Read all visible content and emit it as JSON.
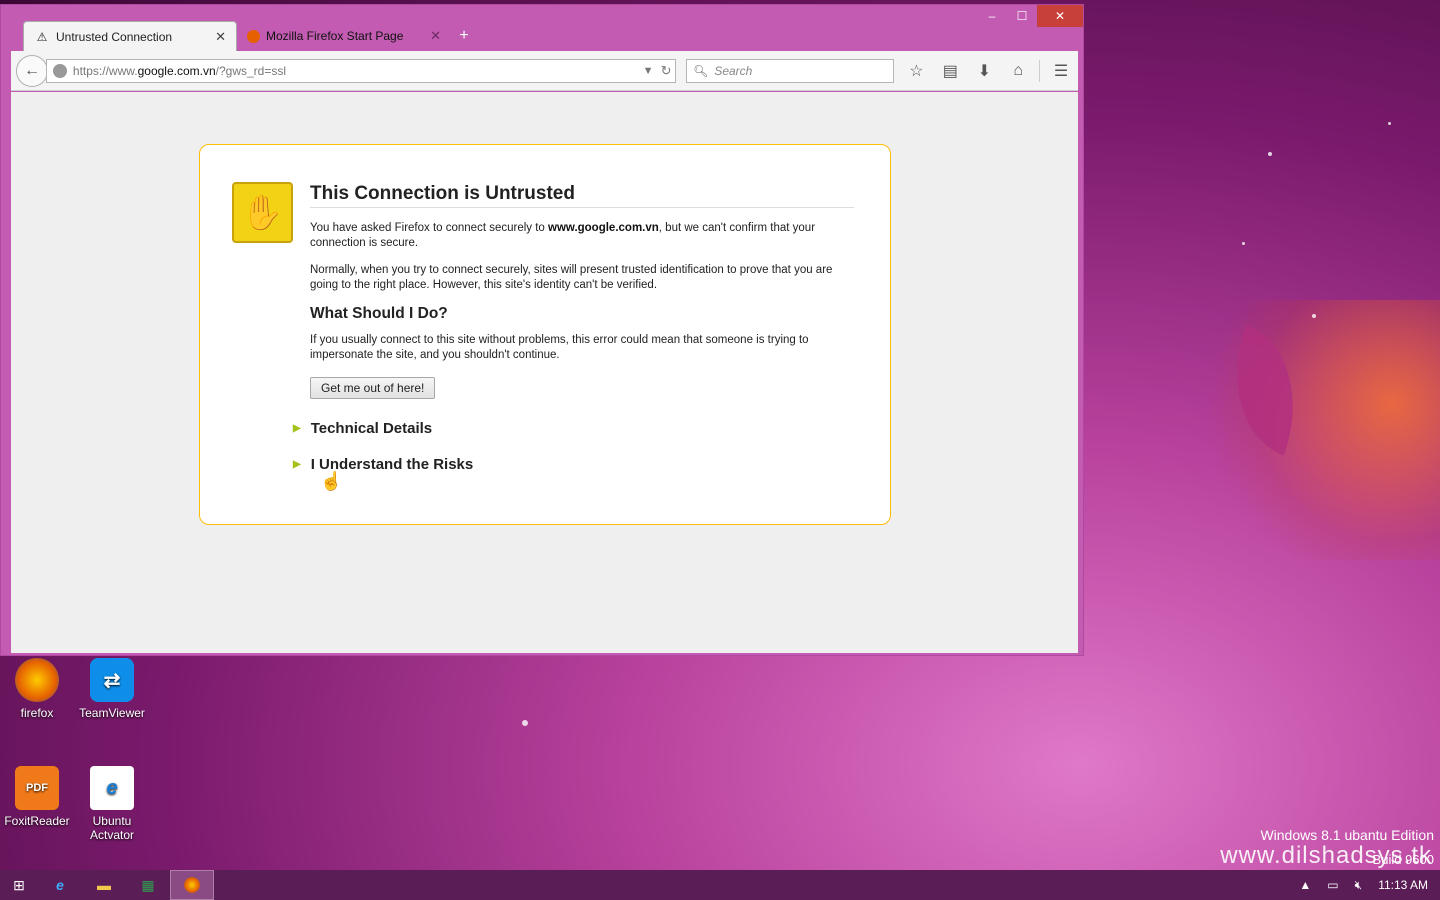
{
  "window": {
    "tabs": [
      {
        "label": "Untrusted Connection",
        "icon": "warning-icon"
      },
      {
        "label": "Mozilla Firefox Start Page",
        "icon": "firefox-icon"
      }
    ],
    "new_tab": "+",
    "controls": {
      "minimize": "–",
      "maximize": "☐",
      "close": "✕"
    }
  },
  "navbar": {
    "url_prefix": "https://www.",
    "url_host": "google.com.vn",
    "url_path": "/?gws_rd=ssl",
    "search_placeholder": "Search"
  },
  "error": {
    "title": "This Connection is Untrusted",
    "p1_before": "You have asked Firefox to connect securely to ",
    "p1_host": "www.google.com.vn",
    "p1_after": ", but we can't confirm that your connection is secure.",
    "p2": "Normally, when you try to connect securely, sites will present trusted identification to prove that you are going to the right place. However, this site's identity can't be verified.",
    "h2": "What Should I Do?",
    "p3": "If you usually connect to this site without problems, this error could mean that someone is trying to impersonate the site, and you shouldn't continue.",
    "button": "Get me out of here!",
    "technical_details": "Technical Details",
    "understand_risks": "I Understand the Risks"
  },
  "desktop": {
    "icons": [
      {
        "label": "firefox"
      },
      {
        "label": "TeamViewer"
      },
      {
        "label": "FoxitReader"
      },
      {
        "label": "Ubuntu Actvator"
      }
    ],
    "watermark_line1": "Windows 8.1 ubantu Edition",
    "watermark_line2": "Build 9600",
    "watermark_site": "www.dilshadsys.tk"
  },
  "taskbar": {
    "clock": "11:13 AM"
  },
  "colors": {
    "error_border": "#ffbd09",
    "close_button": "#c7403a",
    "window_frame": "#c25bb1"
  }
}
